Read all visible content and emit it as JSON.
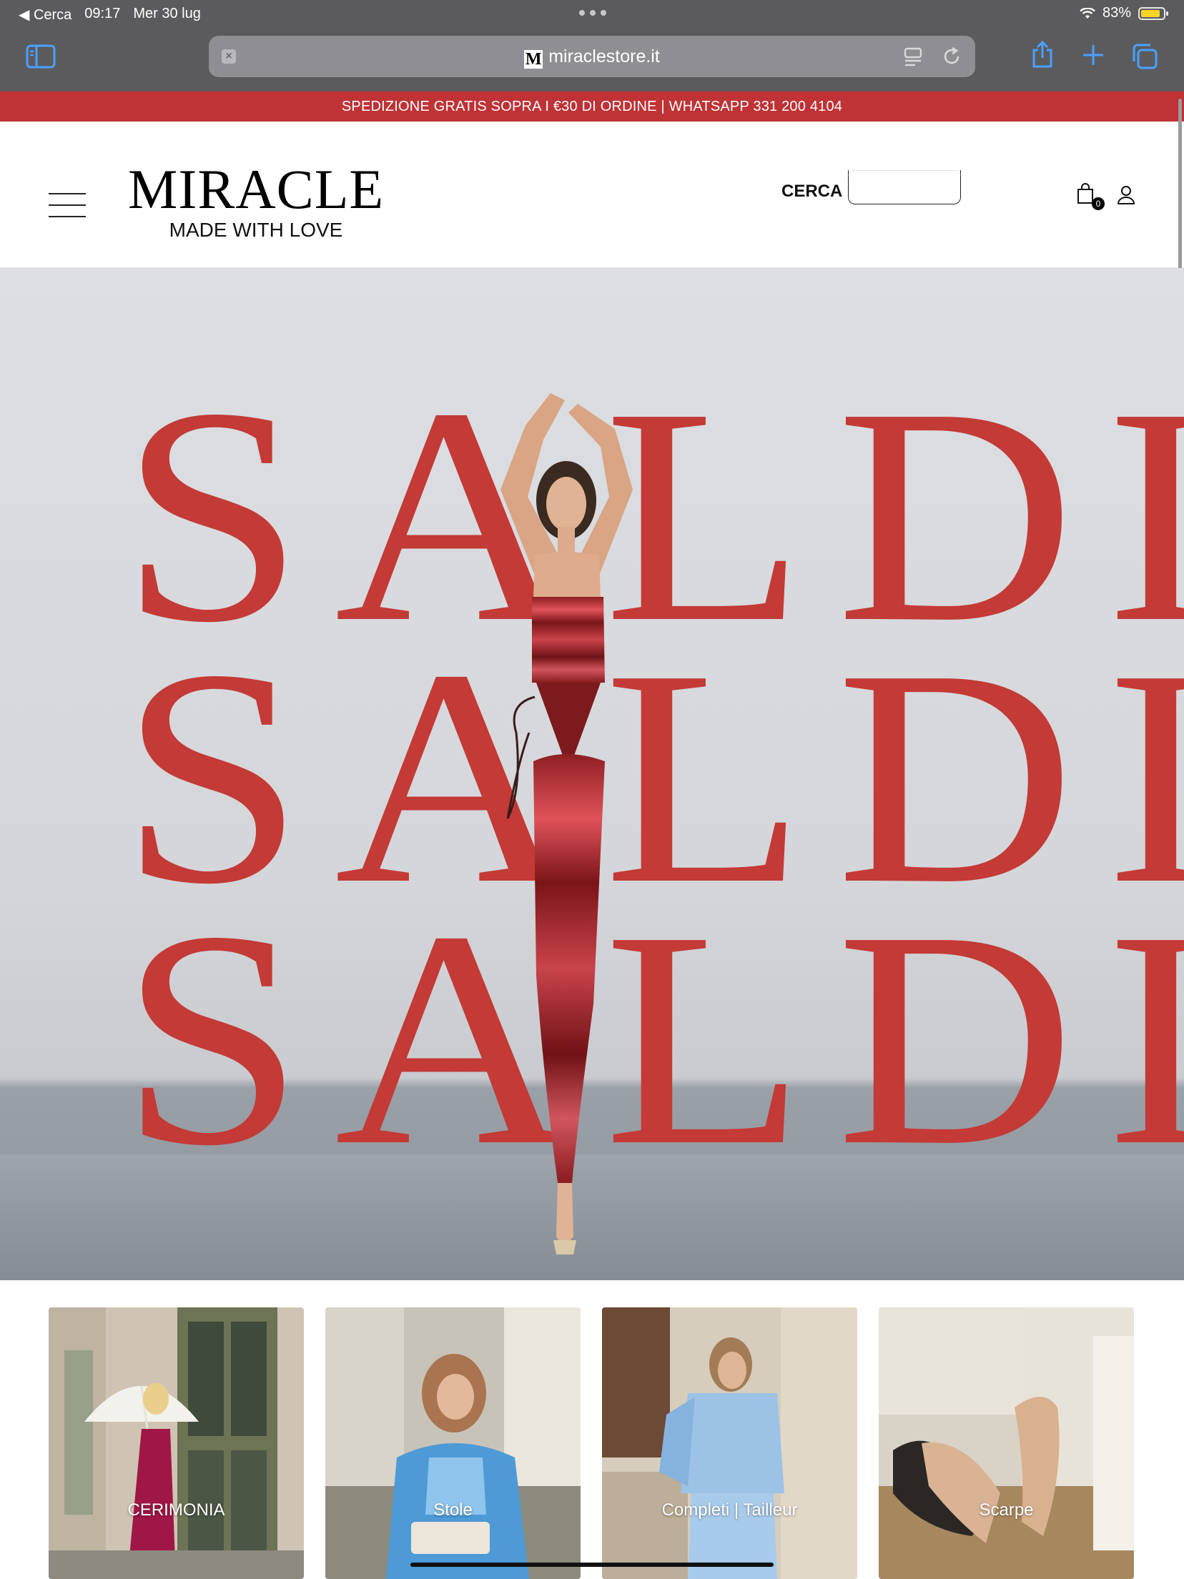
{
  "status_bar": {
    "back_app": "◀ Cerca",
    "time": "09:17",
    "date": "Mer 30 lug",
    "battery": "83%"
  },
  "browser": {
    "url": "miraclestore.it",
    "favicon_letter": "M",
    "icons": [
      "sidebar-icon",
      "close-tab-icon",
      "reader-icon",
      "reload-icon",
      "share-icon",
      "new-tab-icon",
      "tabs-icon"
    ]
  },
  "announcement": "SPEDIZIONE GRATIS SOPRA I €30 DI ORDINE | WHATSAPP 331 200 4104",
  "header": {
    "logo_name": "MIRACLE",
    "logo_tagline": "MADE WITH LOVE",
    "search_label": "CERCA",
    "search_value": "",
    "cart_count": "0"
  },
  "hero": {
    "lines": [
      "SALDI",
      "SALDI",
      "SALDI"
    ],
    "text_color": "#c33a36"
  },
  "categories": [
    {
      "label": "CERIMONIA"
    },
    {
      "label": "Stole"
    },
    {
      "label": "Completi | Tailleur"
    },
    {
      "label": "Scarpe"
    }
  ],
  "colors": {
    "announcement_bg": "#bf3235",
    "browser_chrome": "#5b5b5d",
    "accent_blue": "#4aa0ff"
  }
}
